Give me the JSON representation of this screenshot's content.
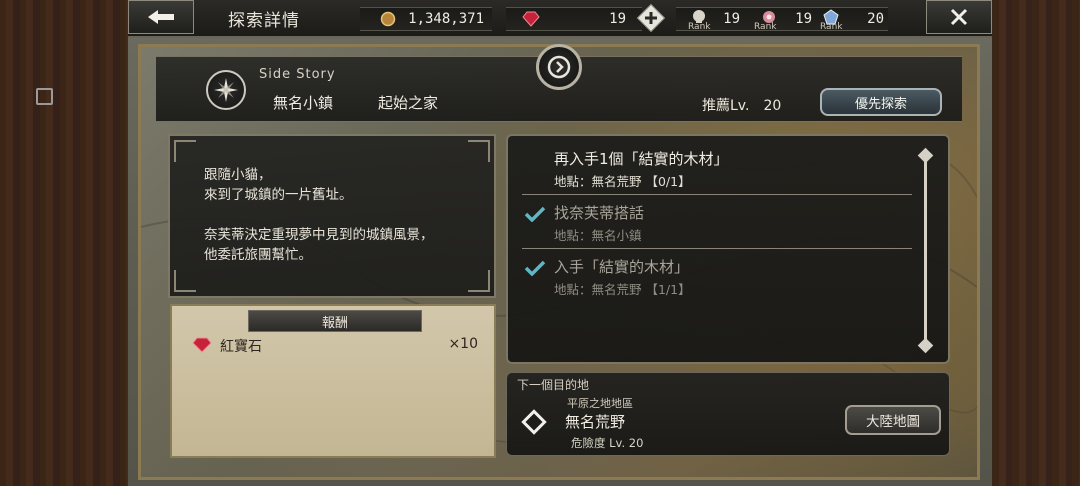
{
  "header": {
    "title": "探索詳情",
    "gold": "1,348,371",
    "gems": "19",
    "rank_label": "Rank",
    "ranks": [
      "19",
      "19",
      "20"
    ]
  },
  "story": {
    "category": "Side Story",
    "location": "無名小鎮",
    "sublocation": "起始之家",
    "recommended_label": "推薦Lv.",
    "recommended_level": "20",
    "priority_button": "優先探索"
  },
  "description": "跟隨小貓，\n來到了城鎮的一片舊址。\n\n奈芙蒂決定重現夢中見到的城鎮風景，\n他委託旅團幫忙。",
  "reward": {
    "title": "報酬",
    "items": [
      {
        "icon": "ruby-icon",
        "name": "紅寶石",
        "qty": "×10"
      }
    ]
  },
  "objectives": [
    {
      "title": "再入手1個「結實的木材」",
      "location": "地點：無名荒野 【0/1】",
      "done": false
    },
    {
      "title": "找奈芙蒂搭話",
      "location": "地點：無名小鎮",
      "done": true
    },
    {
      "title": "入手「結實的木材」",
      "location": "地點：無名荒野 【1/1】",
      "done": true
    }
  ],
  "destination": {
    "label": "下一個目的地",
    "region": "平原之地地區",
    "name": "無名荒野",
    "danger": "危險度 Lv. 20",
    "map_button": "大陸地圖"
  },
  "colors": {
    "accent_check": "#5fb6c4",
    "ruby": "#c8213a",
    "parchment": "#cbbf9f"
  }
}
